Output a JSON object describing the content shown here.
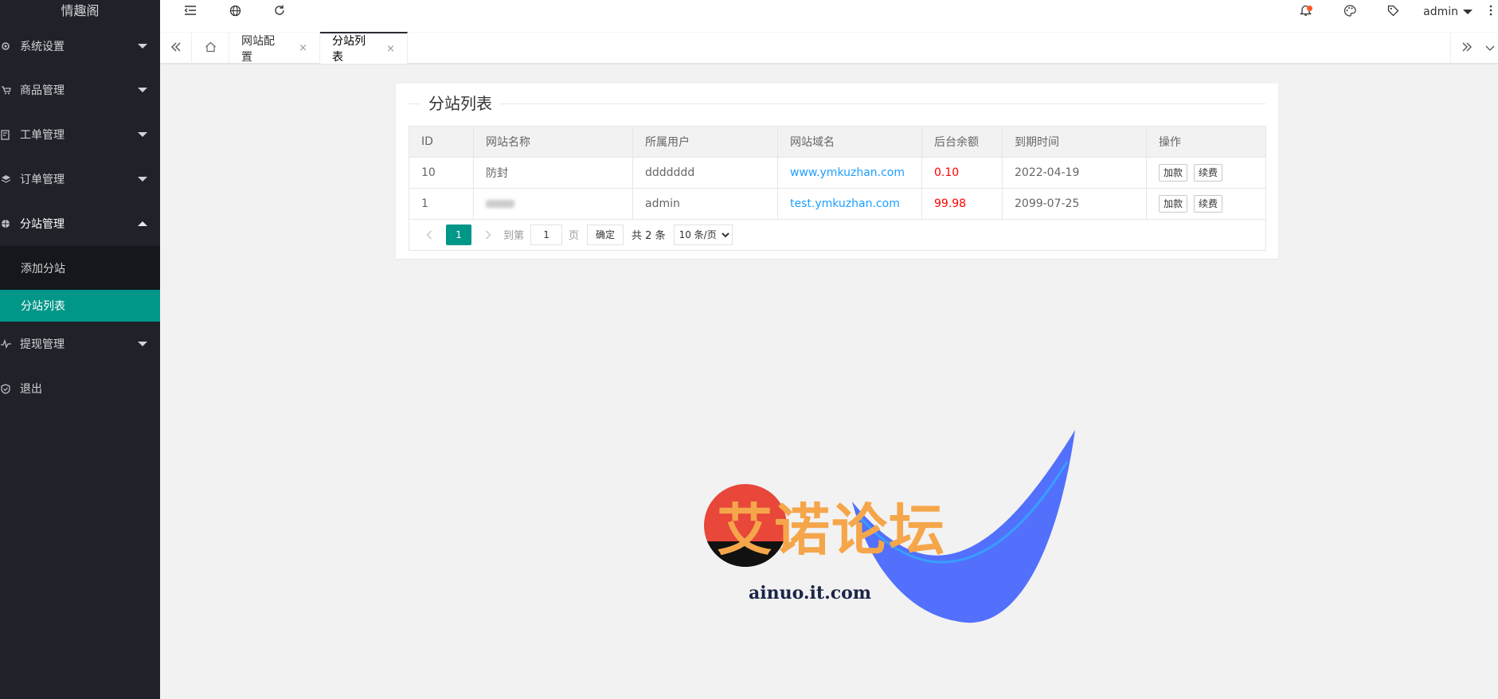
{
  "app": {
    "logo": "情趣阁"
  },
  "sidebar": {
    "items": [
      {
        "label": "系统设置",
        "icon": "gear-icon"
      },
      {
        "label": "商品管理",
        "icon": "cart-icon"
      },
      {
        "label": "工单管理",
        "icon": "ticket-icon"
      },
      {
        "label": "订单管理",
        "icon": "layers-icon"
      },
      {
        "label": "分站管理",
        "icon": "globe-icon"
      },
      {
        "label": "提现管理",
        "icon": "pulse-icon"
      },
      {
        "label": "退出",
        "icon": "shield-icon"
      }
    ],
    "submenu": [
      {
        "label": "添加分站"
      },
      {
        "label": "分站列表"
      }
    ]
  },
  "header": {
    "user": "admin"
  },
  "tabs": {
    "items": [
      {
        "label": "网站配置",
        "close": "×"
      },
      {
        "label": "分站列表",
        "close": "×"
      }
    ]
  },
  "card": {
    "title": "分站列表",
    "columns": [
      "ID",
      "网站名称",
      "所属用户",
      "网站域名",
      "后台余额",
      "到期时间",
      "操作"
    ],
    "rows": [
      {
        "id": "10",
        "name": "防封",
        "user": "ddddddd",
        "domain": "www.ymkuzhan.com",
        "balance": "0.10",
        "expire": "2022-04-19",
        "btn1": "加款",
        "btn2": "续费"
      },
      {
        "id": "1",
        "name": "",
        "user": "admin",
        "domain": "test.ymkuzhan.com",
        "balance": "99.98",
        "expire": "2099-07-25",
        "btn1": "加款",
        "btn2": "续费"
      }
    ]
  },
  "pager": {
    "current": "1",
    "goto_label": "到第",
    "page_value": "1",
    "page_unit": "页",
    "ok": "确定",
    "total": "共 2 条",
    "page_size": "10 条/页"
  },
  "watermark": {
    "text": "艾诺论坛",
    "url": "ainuo.it.com"
  },
  "colors": {
    "sidebar_bg": "#20222a",
    "accent": "#009688",
    "link": "#1e9fff",
    "balance": "#ff0000",
    "badge": "#ff5722"
  }
}
